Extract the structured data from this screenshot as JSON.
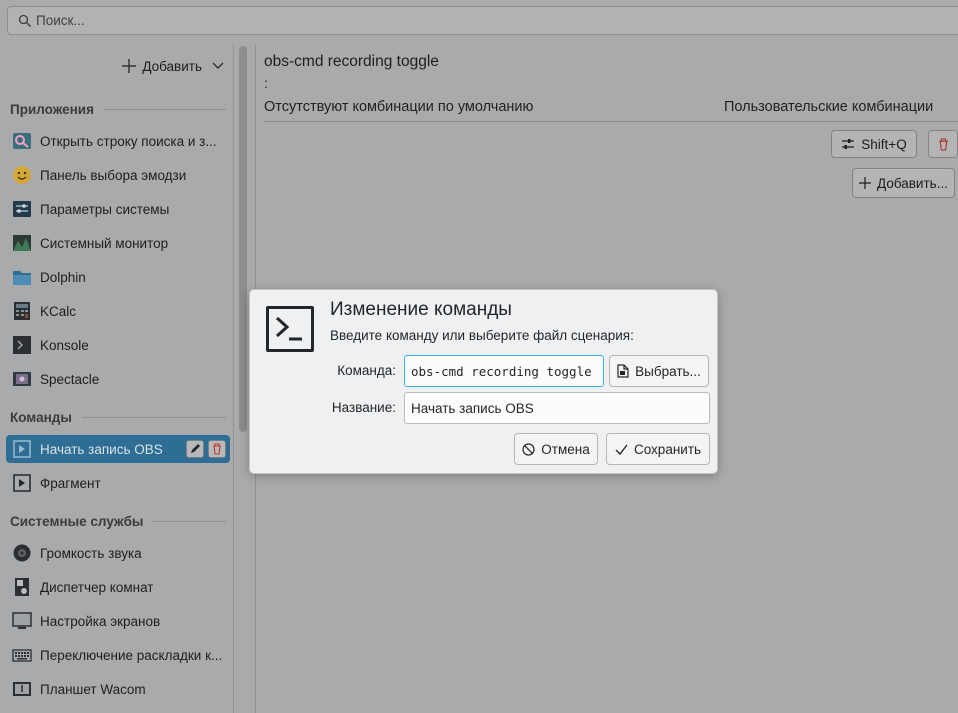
{
  "search": {
    "placeholder": "Поиск..."
  },
  "sidebar": {
    "add_label": "Добавить",
    "sections": {
      "apps": "Приложения",
      "commands": "Команды",
      "services": "Системные службы"
    },
    "apps": [
      {
        "label": "Открыть строку поиска и з...",
        "icon": "search-app-icon"
      },
      {
        "label": "Панель выбора эмодзи",
        "icon": "emoji-icon"
      },
      {
        "label": "Параметры системы",
        "icon": "settings-app-icon"
      },
      {
        "label": "Системный монитор",
        "icon": "system-monitor-icon"
      },
      {
        "label": "Dolphin",
        "icon": "folder-icon"
      },
      {
        "label": "KCalc",
        "icon": "calculator-icon"
      },
      {
        "label": "Konsole",
        "icon": "terminal-icon"
      },
      {
        "label": "Spectacle",
        "icon": "screenshot-icon"
      }
    ],
    "commands": [
      {
        "label": "Начать запись OBS",
        "icon": "script-icon",
        "selected": true
      },
      {
        "label": "Фрагмент",
        "icon": "script-icon"
      }
    ],
    "services": [
      {
        "label": "Громкость звука",
        "icon": "speaker-icon"
      },
      {
        "label": "Диспетчер комнат",
        "icon": "activity-icon"
      },
      {
        "label": "Настройка экранов",
        "icon": "monitor-icon"
      },
      {
        "label": "Переключение раскладки к...",
        "icon": "keyboard-icon"
      },
      {
        "label": "Планшет Wacom",
        "icon": "tablet-icon"
      }
    ]
  },
  "content": {
    "title": "obs-cmd recording toggle",
    "colon": ":",
    "default_header": "Отсутствуют комбинации по умолчанию",
    "custom_header": "Пользовательские комбинации",
    "shortcut": "Shift+Q",
    "add_label": "Добавить..."
  },
  "dialog": {
    "title": "Изменение команды",
    "subtitle": "Введите команду или выберите файл сценария:",
    "command_label": "Команда:",
    "command_value": "obs-cmd recording toggle",
    "choose_label": "Выбрать...",
    "name_label": "Название:",
    "name_value": "Начать запись OBS",
    "cancel_label": "Отмена",
    "save_label": "Сохранить"
  },
  "colors": {
    "selection": "#2f6e94",
    "focus": "#3daee9",
    "dim_background": "#a9aaab",
    "dialog_background": "#eff0f1"
  }
}
